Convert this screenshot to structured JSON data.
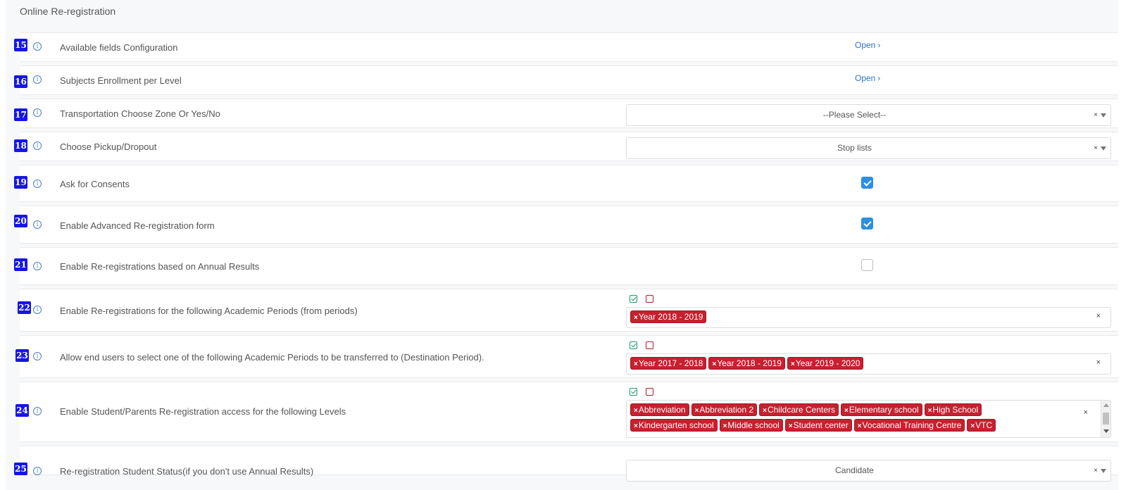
{
  "section": {
    "title": "Online Re-registration"
  },
  "info_glyph": "i",
  "icons": {
    "info": "info-circle-icon",
    "open_chevron": "chevron-right-icon",
    "select_all": "check-square-icon",
    "deselect_all": "square-icon",
    "clear": "close-icon",
    "dropdown": "caret-down-icon"
  },
  "colors": {
    "badge": "#1515e6",
    "tag": "#c7202f",
    "link": "#2f6fd1",
    "checkbox": "#2d8fe0",
    "select_all": "#1c9a6a",
    "deselect_all": "#b01c2e"
  },
  "rows": [
    {
      "num": "15",
      "label": "Available fields Configuration",
      "control": "link",
      "link_text": "Open",
      "chevron": "›"
    },
    {
      "num": "16",
      "label": "Subjects Enrollment per Level",
      "control": "link",
      "link_text": "Open",
      "chevron": "›"
    },
    {
      "num": "17",
      "label": "Transportation Choose Zone Or Yes/No",
      "control": "select",
      "value": "--Please Select--",
      "clear": "×"
    },
    {
      "num": "18",
      "label": "Choose Pickup/Dropout",
      "control": "select",
      "value": "Stop lists",
      "clear": "×"
    },
    {
      "num": "19",
      "label": "Ask for Consents",
      "control": "checkbox",
      "checked": true
    },
    {
      "num": "20",
      "label": "Enable Advanced Re-registration form",
      "control": "checkbox",
      "checked": true
    },
    {
      "num": "21",
      "label": "Enable Re-registrations based on Annual Results",
      "control": "checkbox",
      "checked": false
    },
    {
      "num": "22",
      "label": "Enable Re-registrations for the following Academic Periods (from periods)",
      "control": "tags",
      "tags": [
        "Year 2018 - 2019"
      ],
      "clear": "×"
    },
    {
      "num": "23",
      "label": "Allow end users to select one of the following Academic Periods to be transferred to (Destination Period).",
      "control": "tags",
      "tags": [
        "Year 2017 - 2018",
        "Year 2018 - 2019",
        "Year 2019 - 2020"
      ],
      "clear": "×"
    },
    {
      "num": "24",
      "label": "Enable Student/Parents Re-registration access for the following Levels",
      "control": "tags",
      "tags": [
        "Abbreviation",
        "Abbreviation 2",
        "Childcare Centers",
        "Elementary school",
        "High School",
        "Kindergarten school",
        "Middle school",
        "Student center",
        "Vocational Training Centre",
        "VTC"
      ],
      "clear": "×"
    },
    {
      "num": "25",
      "label": "Re-registration Student Status(if you don't use Annual Results)",
      "control": "select",
      "value": "Candidate",
      "clear": "×"
    }
  ],
  "tag_remove_glyph": "×"
}
